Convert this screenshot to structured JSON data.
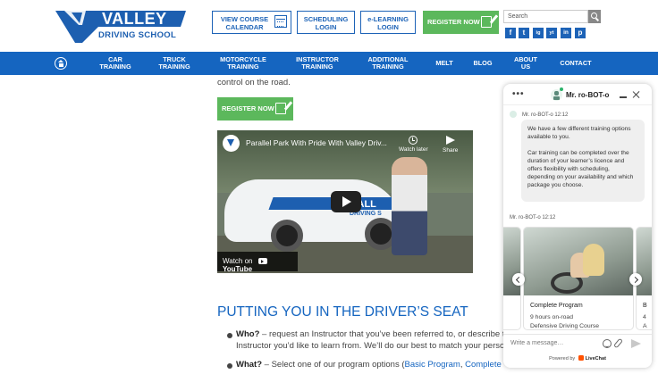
{
  "logo": {
    "line1": "VALLEY",
    "line2": "DRIVING SCHOOL"
  },
  "header": {
    "buttons": [
      {
        "l1": "VIEW COURSE",
        "l2": "CALENDAR"
      },
      {
        "l1": "SCHEDULING",
        "l2": "LOGIN"
      },
      {
        "l1": "e-LEARNING",
        "l2": "LOGIN"
      }
    ],
    "register_label": "REGISTER NOW",
    "search_placeholder": "Search",
    "social": [
      "f",
      "t",
      "ig",
      "yt",
      "in",
      "p"
    ]
  },
  "nav": [
    {
      "l1": "CAR",
      "l2": "TRAINING"
    },
    {
      "l1": "TRUCK",
      "l2": "TRAINING"
    },
    {
      "l1": "MOTORCYCLE",
      "l2": "TRAINING"
    },
    {
      "l1": "INSTRUCTOR",
      "l2": "TRAINING"
    },
    {
      "l1": "ADDITIONAL",
      "l2": "TRAINING"
    },
    {
      "l1": "MELT",
      "l2": ""
    },
    {
      "l1": "BLOG",
      "l2": ""
    },
    {
      "l1": "ABOUT",
      "l2": "US"
    },
    {
      "l1": "CONTACT",
      "l2": ""
    }
  ],
  "content": {
    "partial_line": "control on the road.",
    "register_label": "REGISTER NOW",
    "video": {
      "title": "Parallel Park With Pride With Valley Driv...",
      "watch_later": "Watch later",
      "share": "Share",
      "watch_on": "Watch on",
      "youtube": "YouTube",
      "car_text_1": "VALL",
      "car_text_2": "DRIVING S"
    },
    "section_title": "PUTTING YOU IN THE DRIVER’S SEAT",
    "bullets": [
      {
        "label": "Who?",
        "line1": " – request an Instructor that you’ve been referred to, or describe the t",
        "line2": "Instructor you’d like to learn from. We’ll do our best to match your personali"
      },
      {
        "label": "What?",
        "line1": " – Select one of our program options (",
        "link1": "Basic Program",
        "sep": ", ",
        "link2": "Complete Program",
        "tail": ","
      }
    ]
  },
  "chat": {
    "bot_name": "Mr. ro-BOT-o",
    "meta1": "Mr. ro-BOT-o 12:12",
    "bubble_p1": "We have a few different training options available to you.",
    "bubble_p2": "Car training can be completed over the duration of your learner’s licence and offers flexibility with scheduling, depending on your availability and which package you choose.",
    "meta2": "Mr. ro-BOT-o 12:12",
    "card": {
      "title": "Complete Program",
      "line1": "9 hours on-road",
      "line2": "Defensive Driving Course"
    },
    "next_card": {
      "title": "B",
      "line1": "4",
      "line2": "A"
    },
    "input_placeholder": "Write a message…",
    "powered_prefix": "Powered by",
    "powered_brand": "LiveChat"
  }
}
